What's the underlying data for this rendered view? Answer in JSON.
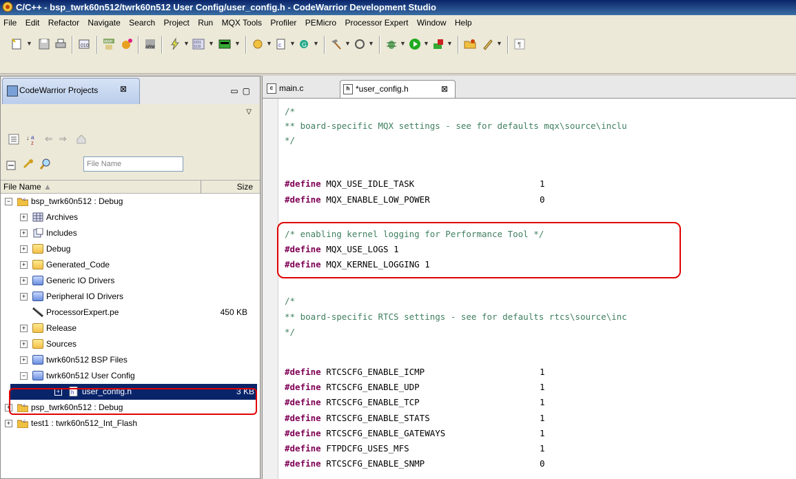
{
  "window": {
    "title": "C/C++ - bsp_twrk60n512/twrk60n512 User Config/user_config.h - CodeWarrior Development Studio"
  },
  "menu": [
    "File",
    "Edit",
    "Refactor",
    "Navigate",
    "Search",
    "Project",
    "Run",
    "MQX Tools",
    "Profiler",
    "PEMicro",
    "Processor Expert",
    "Window",
    "Help"
  ],
  "projects_panel": {
    "title": "CodeWarrior Projects",
    "filter_placeholder": "File Name",
    "col_name": "File Name",
    "col_size": "Size",
    "items": [
      {
        "label": "bsp_twrk60n512 : Debug",
        "size": ""
      },
      {
        "label": "Archives",
        "size": ""
      },
      {
        "label": "Includes",
        "size": ""
      },
      {
        "label": "Debug",
        "size": ""
      },
      {
        "label": "Generated_Code",
        "size": ""
      },
      {
        "label": "Generic IO Drivers",
        "size": ""
      },
      {
        "label": "Peripheral IO Drivers",
        "size": ""
      },
      {
        "label": "ProcessorExpert.pe",
        "size": "450 KB"
      },
      {
        "label": "Release",
        "size": ""
      },
      {
        "label": "Sources",
        "size": ""
      },
      {
        "label": "twrk60n512 BSP Files",
        "size": ""
      },
      {
        "label": "twrk60n512 User Config",
        "size": ""
      },
      {
        "label": "user_config.h",
        "size": "3 KB"
      },
      {
        "label": "psp_twrk60n512 : Debug",
        "size": ""
      },
      {
        "label": "test1 : twrk60n512_Int_Flash",
        "size": ""
      }
    ]
  },
  "editor": {
    "tabs": [
      "main.c",
      "*user_config.h"
    ],
    "code": [
      {
        "kind": "cmt",
        "text": "/*"
      },
      {
        "kind": "cmt",
        "text": "** board-specific MQX settings - see for defaults mqx\\source\\inclu"
      },
      {
        "kind": "cmt",
        "text": "*/"
      },
      {
        "kind": "def",
        "name": "MQX_USE_IDLE_TASK",
        "value": "1"
      },
      {
        "kind": "def",
        "name": "MQX_ENABLE_LOW_POWER",
        "value": "0"
      },
      {
        "kind": "cmt",
        "text": "/* enabling kernel logging for Performance Tool */"
      },
      {
        "kind": "def",
        "name": "MQX_USE_LOGS",
        "value": "1"
      },
      {
        "kind": "def",
        "name": "MQX_KERNEL_LOGGING",
        "value": "1"
      },
      {
        "kind": "cmt",
        "text": "/*"
      },
      {
        "kind": "cmt",
        "text": "** board-specific RTCS settings - see for defaults rtcs\\source\\inc"
      },
      {
        "kind": "cmt",
        "text": "*/"
      },
      {
        "kind": "def",
        "name": "RTCSCFG_ENABLE_ICMP",
        "value": "1"
      },
      {
        "kind": "def",
        "name": "RTCSCFG_ENABLE_UDP",
        "value": "1"
      },
      {
        "kind": "def",
        "name": "RTCSCFG_ENABLE_TCP",
        "value": "1"
      },
      {
        "kind": "def",
        "name": "RTCSCFG_ENABLE_STATS",
        "value": "1"
      },
      {
        "kind": "def",
        "name": "RTCSCFG_ENABLE_GATEWAYS",
        "value": "1"
      },
      {
        "kind": "def",
        "name": "FTPDCFG_USES_MFS",
        "value": "1"
      },
      {
        "kind": "def",
        "name": "RTCSCFG_ENABLE_SNMP",
        "value": "0"
      }
    ],
    "define_keyword": "#define"
  }
}
